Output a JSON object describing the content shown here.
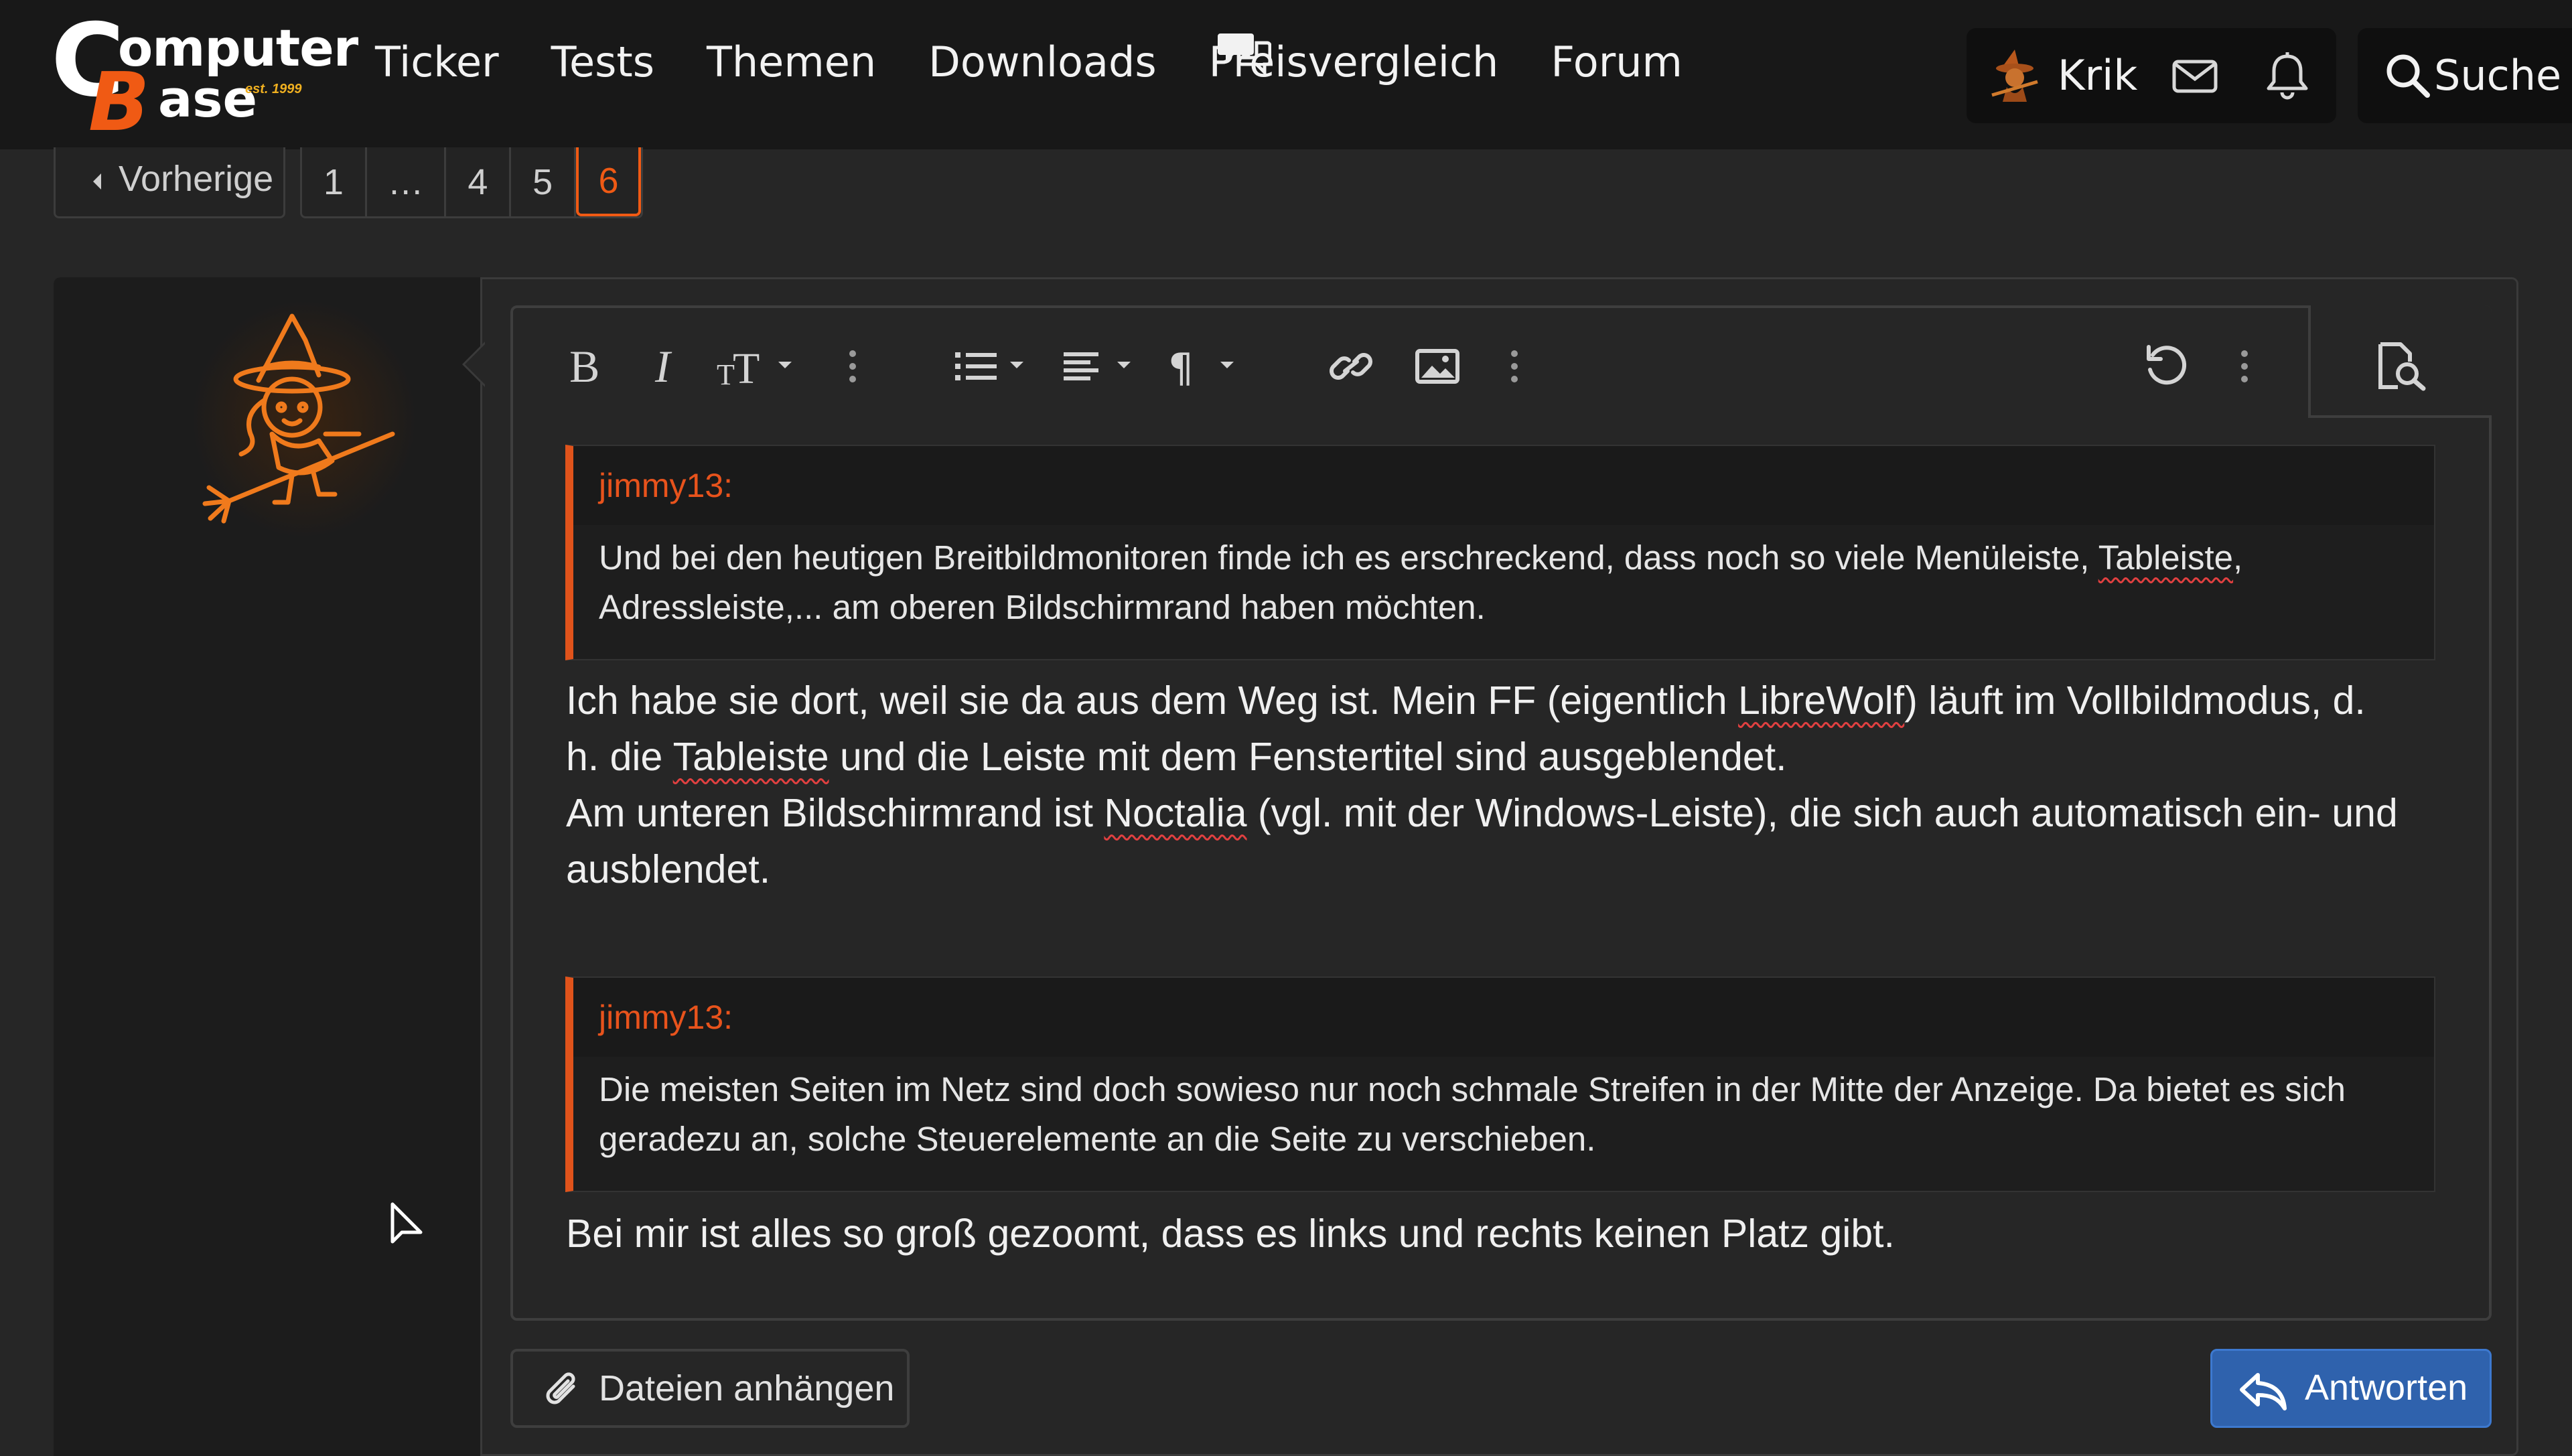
{
  "brand": {
    "logo_letter_c": "C",
    "logo_letter_b": "B",
    "logo_word1": "omputer",
    "logo_word2": "ase",
    "logo_est": "est. 1999"
  },
  "nav": {
    "items": [
      "Ticker",
      "Tests",
      "Themen",
      "Downloads",
      "Preisvergleich",
      "Forum"
    ],
    "icons": [
      "forum-chat-icon"
    ]
  },
  "user": {
    "name": "Krik",
    "icons": [
      "avatar-witch-icon",
      "mail-icon",
      "bell-icon"
    ]
  },
  "search": {
    "label": "Suche"
  },
  "pagination": {
    "prev_label": "Vorherige",
    "pages": [
      "1",
      "…",
      "4",
      "5",
      "6"
    ],
    "current": "6"
  },
  "editor": {
    "toolbar": [
      "bold",
      "italic",
      "text-size",
      "more-text",
      "list",
      "align",
      "paragraph",
      "link",
      "image",
      "more-insert",
      "undo",
      "more",
      "preview"
    ],
    "quotes": [
      {
        "author": "jimmy13:",
        "lines": [
          "Und bei den heutigen Breitbildmonitoren finde ich es erschreckend, dass noch so viele Menüleiste, ",
          "Tableiste",
          ",",
          "Adressleiste,... am oberen Bildschirmrand haben möchten."
        ]
      },
      {
        "author": "jimmy13:",
        "lines": [
          "Die meisten Seiten im Netz sind doch sowieso nur noch schmale Streifen in der Mitte der Anzeige. Da bietet es sich",
          "geradezu an, solche Steuerelemente an die Seite zu verschieben."
        ]
      }
    ],
    "body1": {
      "a": "Ich habe sie dort, weil sie da aus dem Weg ist. Mein FF (eigentlich ",
      "b": "LibreWolf",
      "c": ") läuft im Vollbildmodus, d.",
      "d": "h. die ",
      "e": "Tableiste",
      "f": " und die Leiste mit dem Fenstertitel sind ausgeblendet.",
      "g": "Am unteren Bildschirmrand ist ",
      "h": "Noctalia",
      "i": " (vgl. mit der Windows-Leiste), die sich auch automatisch ein- und",
      "j": "ausblendet."
    },
    "body2": "Bei mir ist alles so groß gezoomt, dass es links und rechts keinen Platz gibt."
  },
  "actions": {
    "attach_label": "Dateien anhängen",
    "reply_label": "Antworten"
  },
  "colors": {
    "accent": "#f05a14",
    "quote_bar": "#e0531b",
    "reply_button": "#2f62ad",
    "background": "#262626",
    "topbar": "#181818"
  }
}
